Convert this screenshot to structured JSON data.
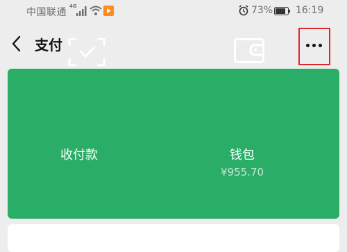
{
  "status_bar": {
    "carrier": "中国联通",
    "network": "4G",
    "battery": "73%",
    "time": "16:19"
  },
  "nav": {
    "title": "支付"
  },
  "card": {
    "receive_label": "收付款",
    "wallet_label": "钱包",
    "balance": "¥955.70",
    "background_color": "#2aae67"
  }
}
